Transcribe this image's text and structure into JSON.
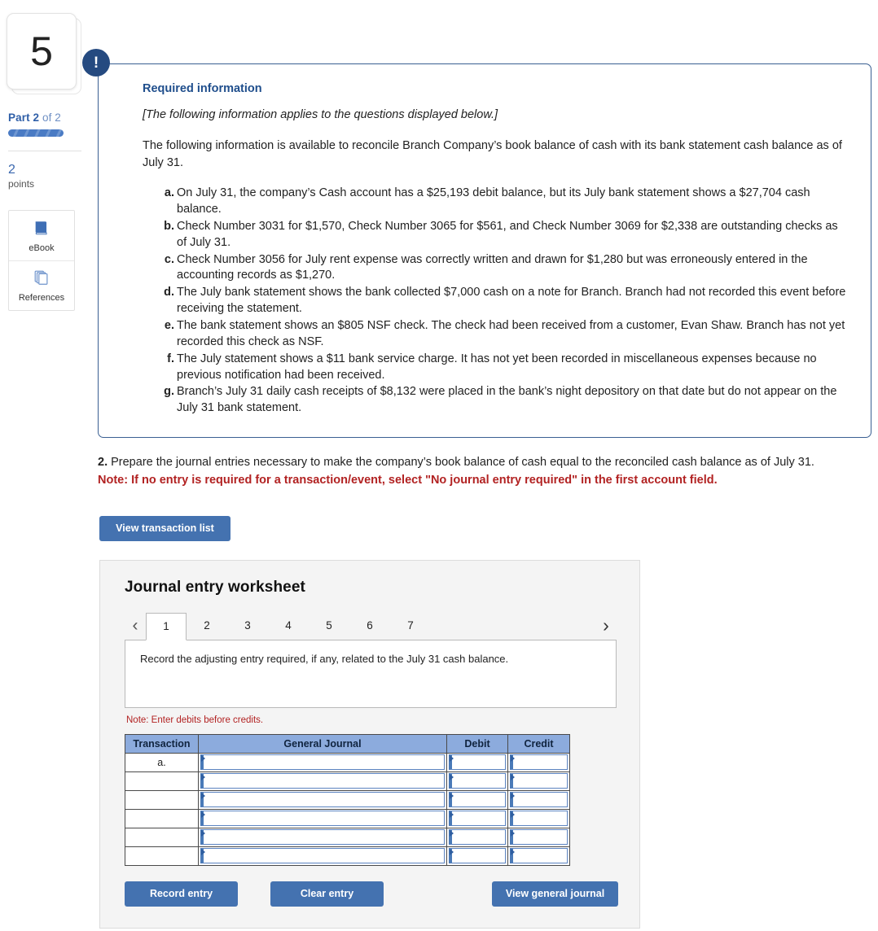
{
  "left_rail": {
    "question_number": "5",
    "part_label_prefix": "Part",
    "part_current": "2",
    "part_of": "of 2",
    "points_value": "2",
    "points_word": "points",
    "tools": [
      {
        "icon": "ebook-icon",
        "label": "eBook"
      },
      {
        "icon": "references-icon",
        "label": "References"
      }
    ]
  },
  "required_info": {
    "alert_glyph": "!",
    "title": "Required information",
    "italic_note": "[The following information applies to the questions displayed below.]",
    "intro": "The following information is available to reconcile Branch Company’s book balance of cash with its bank statement cash balance as of July 31.",
    "items": [
      {
        "marker": "a.",
        "text": "On July 31, the company’s Cash account has a $25,193 debit balance, but its July bank statement shows a $27,704 cash balance."
      },
      {
        "marker": "b.",
        "text": "Check Number 3031 for $1,570, Check Number 3065 for $561, and Check Number 3069 for $2,338 are outstanding checks as of July 31."
      },
      {
        "marker": "c.",
        "text": "Check Number 3056 for July rent expense was correctly written and drawn for $1,280 but was erroneously entered in the accounting records as $1,270."
      },
      {
        "marker": "d.",
        "text": "The July bank statement shows the bank collected $7,000 cash on a note for Branch. Branch had not recorded this event before receiving the statement."
      },
      {
        "marker": "e.",
        "text": "The bank statement shows an $805 NSF check. The check had been received from a customer, Evan Shaw. Branch has not yet recorded this check as NSF."
      },
      {
        "marker": "f.",
        "text": "The July statement shows a $11 bank service charge. It has not yet been recorded in miscellaneous expenses because no previous notification had been received."
      },
      {
        "marker": "g.",
        "text": "Branch’s July 31 daily cash receipts of $8,132 were placed in the bank’s night depository on that date but do not appear on the July 31 bank statement."
      }
    ]
  },
  "question": {
    "number": "2.",
    "text": " Prepare the journal entries necessary to make the company’s book balance of cash equal to the reconciled cash balance as of July 31.",
    "note": "Note: If no entry is required for a transaction/event, select \"No journal entry required\" in the first account field.",
    "view_transaction_list_label": "View transaction list"
  },
  "worksheet": {
    "title": "Journal entry worksheet",
    "prev_arrow": "‹",
    "next_arrow": "›",
    "tabs": [
      "1",
      "2",
      "3",
      "4",
      "5",
      "6",
      "7"
    ],
    "active_tab": "1",
    "instruction": "Record the adjusting entry required, if any, related to the July 31 cash balance.",
    "debits_note": "Note: Enter debits before credits.",
    "table": {
      "headers": [
        "Transaction",
        "General Journal",
        "Debit",
        "Credit"
      ],
      "rows": [
        {
          "transaction": "a.",
          "general_journal": "",
          "debit": "",
          "credit": ""
        },
        {
          "transaction": "",
          "general_journal": "",
          "debit": "",
          "credit": ""
        },
        {
          "transaction": "",
          "general_journal": "",
          "debit": "",
          "credit": ""
        },
        {
          "transaction": "",
          "general_journal": "",
          "debit": "",
          "credit": ""
        },
        {
          "transaction": "",
          "general_journal": "",
          "debit": "",
          "credit": ""
        },
        {
          "transaction": "",
          "general_journal": "",
          "debit": "",
          "credit": ""
        }
      ]
    },
    "buttons": {
      "record_entry": "Record entry",
      "clear_entry": "Clear entry",
      "view_general_journal": "View general journal"
    }
  },
  "colors": {
    "accent_blue": "#4472b0",
    "header_blue": "#8cabdd",
    "alert_navy": "#254a80",
    "note_red": "#b22222",
    "panel_gray": "#f4f4f4"
  }
}
